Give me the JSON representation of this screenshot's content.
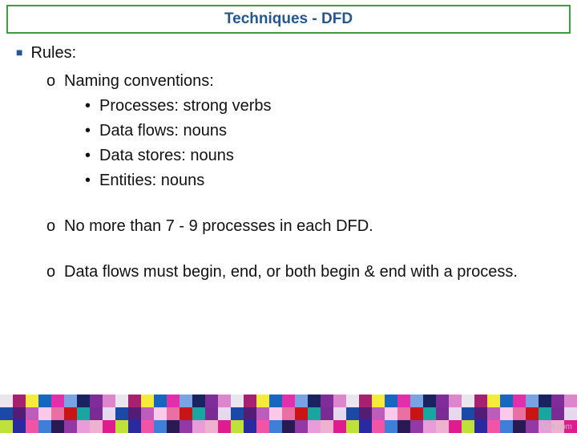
{
  "title": "Techniques - DFD",
  "rules_label": "Rules:",
  "items": {
    "naming": "Naming conventions:",
    "sub": {
      "processes": "Processes: strong verbs",
      "dataflows": "Data flows: nouns",
      "datastores": "Data stores: nouns",
      "entities": "Entities: nouns"
    },
    "max_processes": "No more than 7 - 9 processes in each DFD.",
    "flows_rule": "Data flows must begin, end, or both begin & end with a process."
  },
  "watermark": "fppt.com",
  "footer_colors": [
    "#e9e6ef",
    "#f2b5d4",
    "#efb1d0",
    "#7e3a7e",
    "#f18fb8",
    "#f3a4c3",
    "#ea6fa3",
    "#e04e8c",
    "#c2207a",
    "#b5186a",
    "#a6216f",
    "#cf2d7f",
    "#de1b8f",
    "#ef2b72",
    "#f04e2b",
    "#e92413",
    "#c71414",
    "#f28f2e",
    "#f6b22f",
    "#f7d233",
    "#f6ea3a",
    "#e7e735",
    "#bee23a",
    "#6fc540",
    "#3aa93f",
    "#2a8f3b",
    "#1aa6a0",
    "#1fb5c5",
    "#23b0d9",
    "#1a8fd0",
    "#1766c0",
    "#1e3fb0",
    "#2a2aa0",
    "#4025a2",
    "#5a1ea0",
    "#6f2398",
    "#7b2c94",
    "#922b95",
    "#a52d9b",
    "#c22ea4",
    "#e031ab",
    "#ec3a9f",
    "#f054a4",
    "#f57eb6",
    "#f8a6cc",
    "#f2cbe0",
    "#e6d8ed",
    "#d4d7ef",
    "#bcc6eb",
    "#9fb6e6",
    "#7aa3e3",
    "#5e92de",
    "#3f7fd8",
    "#3573ce",
    "#2b67c4",
    "#2055b7",
    "#1a49a7",
    "#153d96",
    "#133486",
    "#162a73",
    "#1a2361",
    "#201d55",
    "#2a1a53",
    "#351856",
    "#3e175e",
    "#471968",
    "#521d73",
    "#5e207e",
    "#6a2489",
    "#742992",
    "#7e2d9a",
    "#8932a1",
    "#9339a6",
    "#9d41ab",
    "#a84ab1",
    "#b253b6",
    "#bc5dbb",
    "#c566c0",
    "#ce71c5",
    "#d57bca",
    "#dc86cf",
    "#e391d4",
    "#ea9cd8",
    "#efa7dc",
    "#f4b3e1",
    "#f7bee5",
    "#fac9e9",
    "#fcd4ed",
    "#fedff1",
    "#ffeaf5"
  ]
}
